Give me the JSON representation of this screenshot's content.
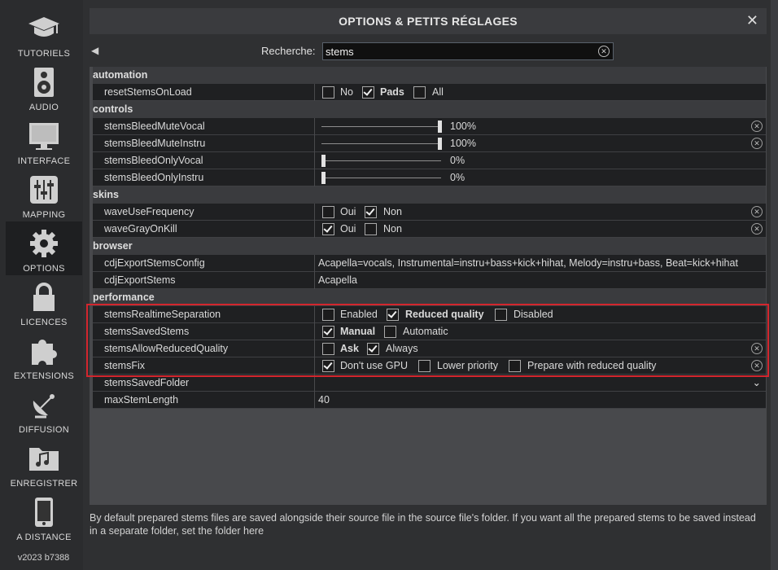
{
  "sidebar": {
    "items": [
      {
        "label": "TUTORIELS",
        "icon": "graduation-cap-icon"
      },
      {
        "label": "AUDIO",
        "icon": "speaker-icon"
      },
      {
        "label": "INTERFACE",
        "icon": "monitor-icon"
      },
      {
        "label": "MAPPING",
        "icon": "sliders-icon"
      },
      {
        "label": "OPTIONS",
        "icon": "gear-icon"
      },
      {
        "label": "LICENCES",
        "icon": "lock-icon"
      },
      {
        "label": "EXTENSIONS",
        "icon": "puzzle-icon"
      },
      {
        "label": "DIFFUSION",
        "icon": "satellite-dish-icon"
      },
      {
        "label": "ENREGISTRER",
        "icon": "music-folder-icon"
      },
      {
        "label": "A DISTANCE",
        "icon": "phone-icon"
      }
    ],
    "active": "OPTIONS",
    "version": "v2023 b7388"
  },
  "dialog": {
    "title": "OPTIONS & PETITS RÉGLAGES",
    "close_icon": "close-icon",
    "search_label": "Recherche:",
    "search_value": "stems"
  },
  "categories": {
    "automation": "automation",
    "controls": "controls",
    "skins": "skins",
    "browser": "browser",
    "performance": "performance"
  },
  "options": {
    "resetStemsOnLoad": {
      "name": "resetStemsOnLoad",
      "choices": [
        "No",
        "Pads",
        "All"
      ],
      "selected": "Pads"
    },
    "stemsBleedMuteVocal": {
      "name": "stemsBleedMuteVocal",
      "value": "100%",
      "level": 1.0
    },
    "stemsBleedMuteInstru": {
      "name": "stemsBleedMuteInstru",
      "value": "100%",
      "level": 1.0
    },
    "stemsBleedOnlyVocal": {
      "name": "stemsBleedOnlyVocal",
      "value": "0%",
      "level": 0.0
    },
    "stemsBleedOnlyInstru": {
      "name": "stemsBleedOnlyInstru",
      "value": "0%",
      "level": 0.0
    },
    "waveUseFrequency": {
      "name": "waveUseFrequency",
      "choices": [
        "Oui",
        "Non"
      ],
      "selected": "Non"
    },
    "waveGrayOnKill": {
      "name": "waveGrayOnKill",
      "choices": [
        "Oui",
        "Non"
      ],
      "selected": "Oui"
    },
    "cdjExportStemsConfig": {
      "name": "cdjExportStemsConfig",
      "value": "Acapella=vocals, Instrumental=instru+bass+kick+hihat, Melody=instru+bass, Beat=kick+hihat"
    },
    "cdjExportStems": {
      "name": "cdjExportStems",
      "value": "Acapella"
    },
    "stemsRealtimeSeparation": {
      "name": "stemsRealtimeSeparation",
      "choices": [
        "Enabled",
        "Reduced quality",
        "Disabled"
      ],
      "selected": "Reduced quality"
    },
    "stemsSavedStems": {
      "name": "stemsSavedStems",
      "choices": [
        "Manual",
        "Automatic"
      ],
      "selected": "Manual"
    },
    "stemsAllowReducedQuality": {
      "name": "stemsAllowReducedQuality",
      "choices": [
        "Ask",
        "Always"
      ],
      "selected": "Always",
      "bold": "Ask"
    },
    "stemsFix": {
      "name": "stemsFix",
      "choices": [
        "Don't use GPU",
        "Lower priority",
        "Prepare with reduced quality"
      ],
      "selected": "Don't use GPU"
    },
    "stemsSavedFolder": {
      "name": "stemsSavedFolder",
      "value": ""
    },
    "maxStemLength": {
      "name": "maxStemLength",
      "value": "40"
    }
  },
  "help_text": "By default prepared stems files are saved alongside their source file in the source file's folder. If you want all the prepared stems to be saved instead in a separate folder, set the folder here"
}
